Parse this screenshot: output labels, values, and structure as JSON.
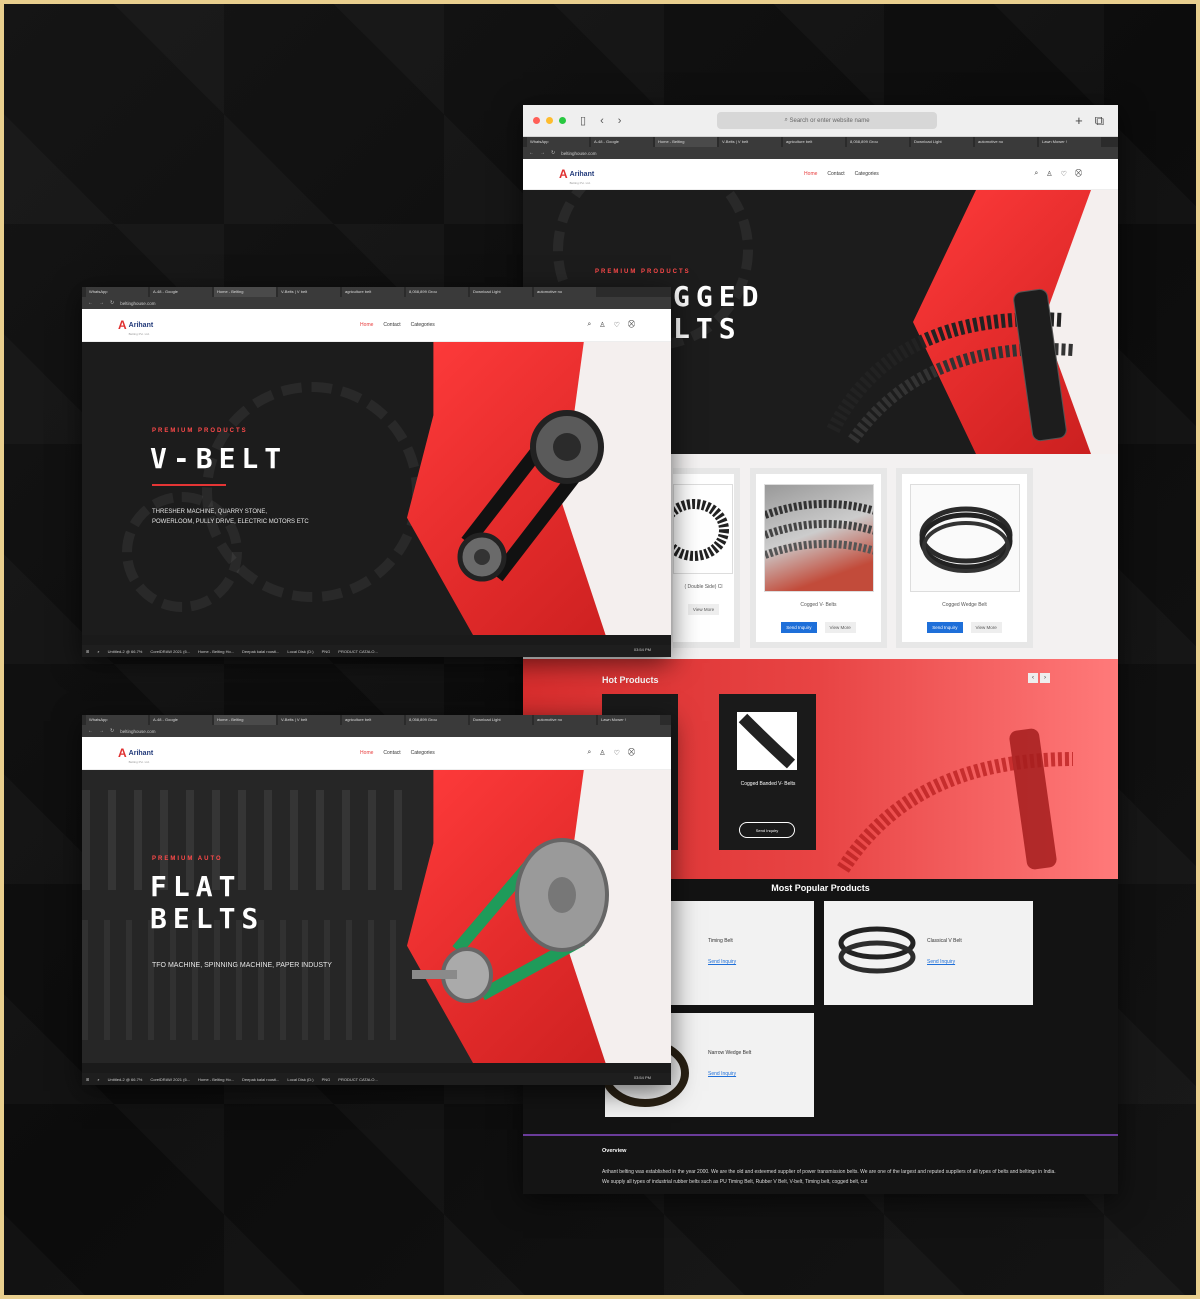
{
  "mac": {
    "search_placeholder": "Search or enter website name"
  },
  "chrome": {
    "tabs": [
      "WhatsApp",
      "A-48 - Google",
      "Home - Belting",
      "V-Belts | V belt",
      "agriculture belt",
      "8,058,899 Grou",
      "Download Light",
      "automotive no",
      "Lawn Mower !"
    ],
    "url": "beltinghouse.com"
  },
  "site": {
    "logo_mark": "A",
    "logo_text": "Arihant",
    "logo_sub": "Belting Pvt. Ltd.",
    "nav": {
      "home": "Home",
      "contact": "Contact",
      "categories": "Categories"
    }
  },
  "hero_main": {
    "kicker": "PREMIUM PRODUCTS",
    "title_line1": "GGED",
    "title_line2": "LTS"
  },
  "products": [
    {
      "name": "( Double Side) Cl",
      "view": "View More"
    },
    {
      "name": "Cogged V- Belts",
      "inquiry": "Send Inquiry",
      "view": "View More"
    },
    {
      "name": "Cogged Wedge Belt",
      "inquiry": "Send Inquiry",
      "view": "View More"
    }
  ],
  "hot": {
    "title": "Hot Products",
    "card_name": "Cogged Banded V- Belts",
    "card_button": "Send Inquiry"
  },
  "popular": {
    "title": "Most Popular Products",
    "items": [
      {
        "name": "Timing Belt",
        "link": "Send Inquiry"
      },
      {
        "name": "Classical V Belt",
        "link": "Send Inquiry"
      },
      {
        "name": "Narrow Wedge Belt",
        "link": "Send Inquiry"
      }
    ]
  },
  "overview": {
    "title": "Overview",
    "text": "Arihant belting was established in the year 2000. We are the old and esteemed supplier of power transmission belts. We are one of the largest and reputed suppliers of all types of belts and beltings in India. We supply all types of industrial rubber belts such as PU Timing Belt, Rubber V Belt, V-belt, Timing belt, cogged belt, cut"
  },
  "vbelt": {
    "kicker": "PREMIUM PRODUCTS",
    "title": "V-BELT",
    "desc_line1": "THRESHER MACHINE, QUARRY STONE,",
    "desc_line2": "POWERLOOM, PULLY DRIVE, ELECTRIC MOTORS ETC"
  },
  "flat": {
    "kicker": "PREMIUM AUTO",
    "title_line1": "FLAT",
    "title_line2": "BELTS",
    "desc": "TFO MACHINE, SPINNING MACHINE, PAPER INDUSTY"
  },
  "taskbar": {
    "items": [
      "Untitled-2 @ 66.7%",
      "CorelDRAW 2021 (6...",
      "Home - Belting Ho...",
      "Deepak kalal roosti...",
      "Local Disk (D:)",
      "PNG",
      "PRODUCT CATALO..."
    ],
    "clock": "03:54 PM"
  },
  "colors": {
    "brand_red": "#e53535",
    "link_blue": "#1e6fd9",
    "frame_gold": "#e9cf8e"
  }
}
